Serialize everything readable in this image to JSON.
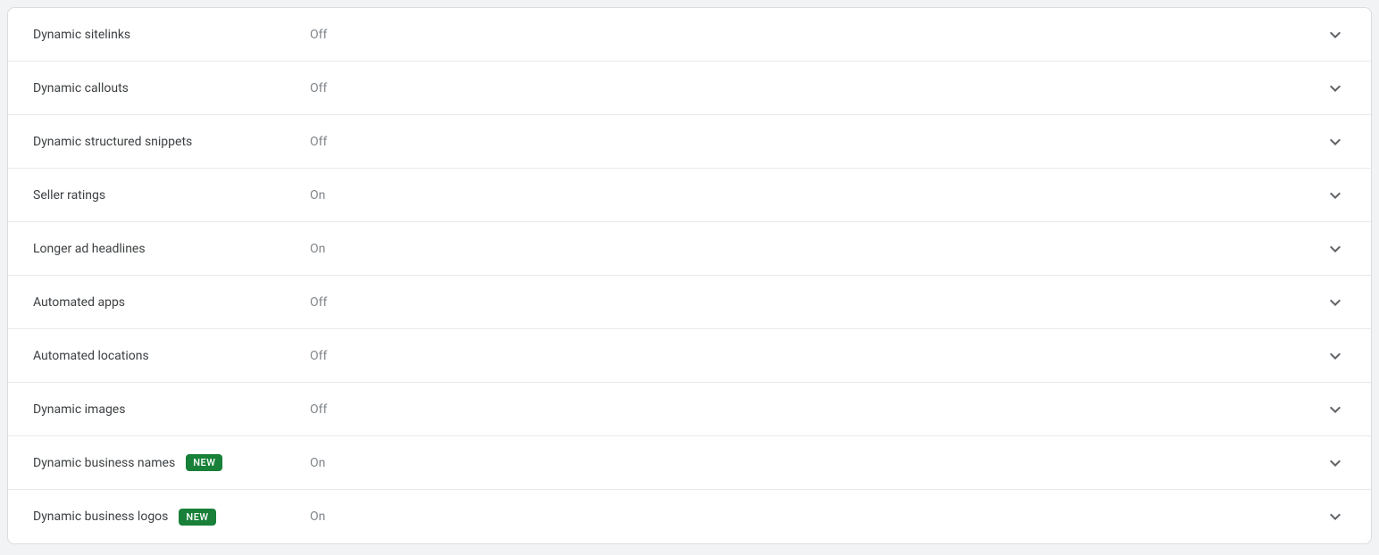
{
  "badge_new": "NEW",
  "settings": [
    {
      "label": "Dynamic sitelinks",
      "status": "Off",
      "new": false
    },
    {
      "label": "Dynamic callouts",
      "status": "Off",
      "new": false
    },
    {
      "label": "Dynamic structured snippets",
      "status": "Off",
      "new": false
    },
    {
      "label": "Seller ratings",
      "status": "On",
      "new": false
    },
    {
      "label": "Longer ad headlines",
      "status": "On",
      "new": false
    },
    {
      "label": "Automated apps",
      "status": "Off",
      "new": false
    },
    {
      "label": "Automated locations",
      "status": "Off",
      "new": false
    },
    {
      "label": "Dynamic images",
      "status": "Off",
      "new": false
    },
    {
      "label": "Dynamic business names",
      "status": "On",
      "new": true
    },
    {
      "label": "Dynamic business logos",
      "status": "On",
      "new": true
    }
  ]
}
